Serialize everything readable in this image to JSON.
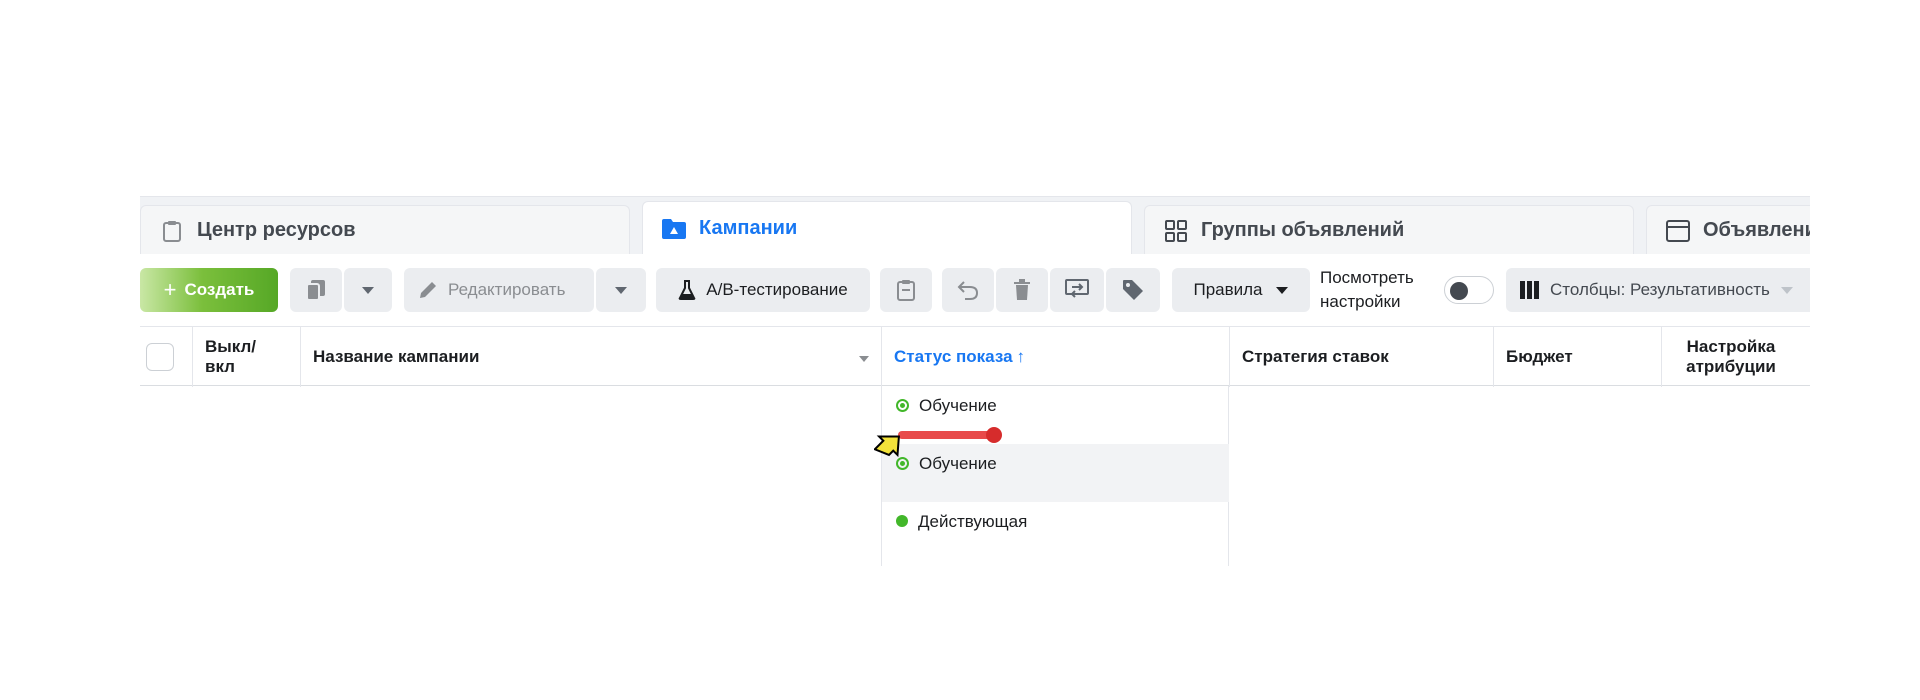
{
  "tabs": {
    "resources": "Центр ресурсов",
    "campaigns": "Кампании",
    "adsets": "Группы объявлений",
    "ads": "Объявления"
  },
  "toolbar": {
    "create": "Создать",
    "edit": "Редактировать",
    "ab_test": "A/B-тестирование",
    "rules": "Правила",
    "view_settings": "Посмотреть настройки",
    "columns": "Столбцы: Результативность"
  },
  "table": {
    "headers": {
      "toggle": "Выкл/вкл",
      "name": "Название кампании",
      "status": "Статус показа",
      "sort_arrow": "↑",
      "bid_strategy": "Стратегия ставок",
      "budget": "Бюджет",
      "attribution": "Настройка атрибуции"
    },
    "rows": [
      {
        "status": "Обучение",
        "status_type": "learning"
      },
      {
        "status": "Обучение",
        "status_type": "learning"
      },
      {
        "status": "Действующая",
        "status_type": "active"
      }
    ]
  },
  "colors": {
    "accent": "#1877f2",
    "create_button": "#56a826",
    "status_green": "#42b72a",
    "drag_indicator": "#e84a4a"
  }
}
